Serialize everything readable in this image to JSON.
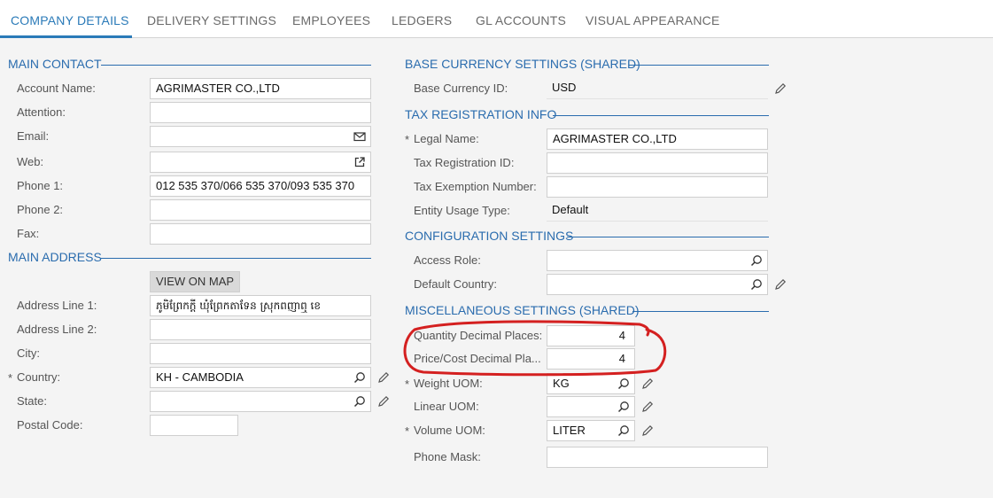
{
  "tabs": [
    "COMPANY DETAILS",
    "DELIVERY SETTINGS",
    "EMPLOYEES",
    "LEDGERS",
    "GL ACCOUNTS",
    "VISUAL APPEARANCE"
  ],
  "main_contact": {
    "title": "MAIN CONTACT",
    "account_name_label": "Account Name:",
    "account_name": "AGRIMASTER CO.,LTD",
    "attention_label": "Attention:",
    "attention": "",
    "email_label": "Email:",
    "email": "",
    "web_label": "Web:",
    "web": "",
    "phone1_label": "Phone 1:",
    "phone1": "012 535 370/066 535 370/093 535 370",
    "phone2_label": "Phone 2:",
    "phone2": "",
    "fax_label": "Fax:",
    "fax": ""
  },
  "main_address": {
    "title": "MAIN ADDRESS",
    "view_on_map": "VIEW ON MAP",
    "address1_label": "Address Line 1:",
    "address1": "ភូមិព្រែកក្ដី ឃុំព្រែកតាទែន ស្រុកពញាឮ ខេ",
    "address2_label": "Address Line 2:",
    "address2": "",
    "city_label": "City:",
    "city": "",
    "country_label": "Country:",
    "country": "KH - CAMBODIA",
    "state_label": "State:",
    "state": "",
    "postal_label": "Postal Code:",
    "postal": ""
  },
  "base_currency": {
    "title": "BASE CURRENCY SETTINGS (SHARED)",
    "currency_label": "Base Currency ID:",
    "currency": "USD"
  },
  "tax_registration": {
    "title": "TAX REGISTRATION INFO",
    "legal_name_label": "Legal Name:",
    "legal_name": "AGRIMASTER CO.,LTD",
    "tax_id_label": "Tax Registration ID:",
    "tax_id": "",
    "exemption_label": "Tax Exemption Number:",
    "exemption": "",
    "entity_usage_label": "Entity Usage Type:",
    "entity_usage": "Default"
  },
  "configuration": {
    "title": "CONFIGURATION SETTINGS",
    "access_role_label": "Access Role:",
    "access_role": "",
    "default_country_label": "Default Country:",
    "default_country": ""
  },
  "misc": {
    "title": "MISCELLANEOUS SETTINGS (SHARED)",
    "qty_decimal_label": "Quantity Decimal Places:",
    "qty_decimal": "4",
    "price_decimal_label": "Price/Cost Decimal Pla...",
    "price_decimal": "4",
    "weight_uom_label": "Weight UOM:",
    "weight_uom": "KG",
    "linear_uom_label": "Linear UOM:",
    "linear_uom": "",
    "volume_uom_label": "Volume UOM:",
    "volume_uom": "LITER",
    "phone_mask_label": "Phone Mask:",
    "phone_mask": ""
  },
  "required_marker": "*",
  "colors": {
    "accent": "#2a7ab8",
    "annotation": "#d42020"
  }
}
